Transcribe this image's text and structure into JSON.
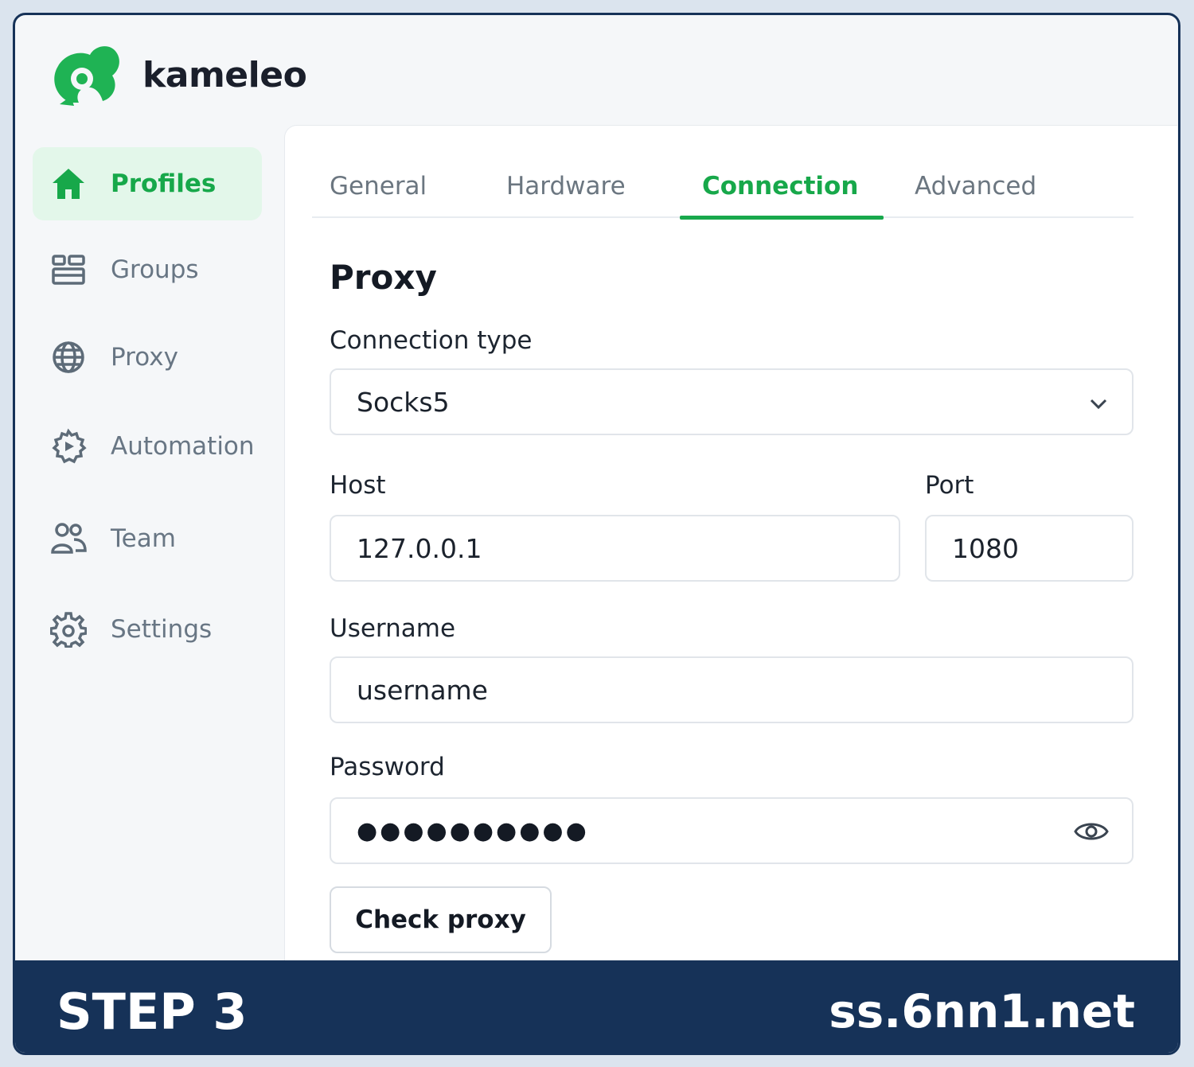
{
  "app": {
    "brand_name": "kameleo",
    "brand_color": "#1fb354"
  },
  "sidebar": {
    "items": [
      {
        "label": "Profiles",
        "icon": "home-icon",
        "active": true
      },
      {
        "label": "Groups",
        "icon": "groups-icon",
        "active": false
      },
      {
        "label": "Proxy",
        "icon": "globe-icon",
        "active": false
      },
      {
        "label": "Automation",
        "icon": "automation-icon",
        "active": false
      },
      {
        "label": "Team",
        "icon": "team-icon",
        "active": false
      },
      {
        "label": "Settings",
        "icon": "gear-icon",
        "active": false
      }
    ]
  },
  "tabs": [
    {
      "label": "General",
      "active": false
    },
    {
      "label": "Hardware",
      "active": false
    },
    {
      "label": "Connection",
      "active": true
    },
    {
      "label": "Advanced",
      "active": false
    }
  ],
  "form": {
    "section_title": "Proxy",
    "connection_type_label": "Connection type",
    "connection_type_value": "Socks5",
    "host_label": "Host",
    "host_value": "127.0.0.1",
    "port_label": "Port",
    "port_value": "1080",
    "username_label": "Username",
    "username_value": "username",
    "password_label": "Password",
    "password_masked": "●●●●●●●●●●",
    "check_button_label": "Check proxy"
  },
  "banner": {
    "step_label": "STEP 3",
    "site_label": "ss.6nn1.net",
    "background": "#163258"
  },
  "colors": {
    "accent": "#17a84a",
    "active_bg": "#e3f7ea"
  }
}
